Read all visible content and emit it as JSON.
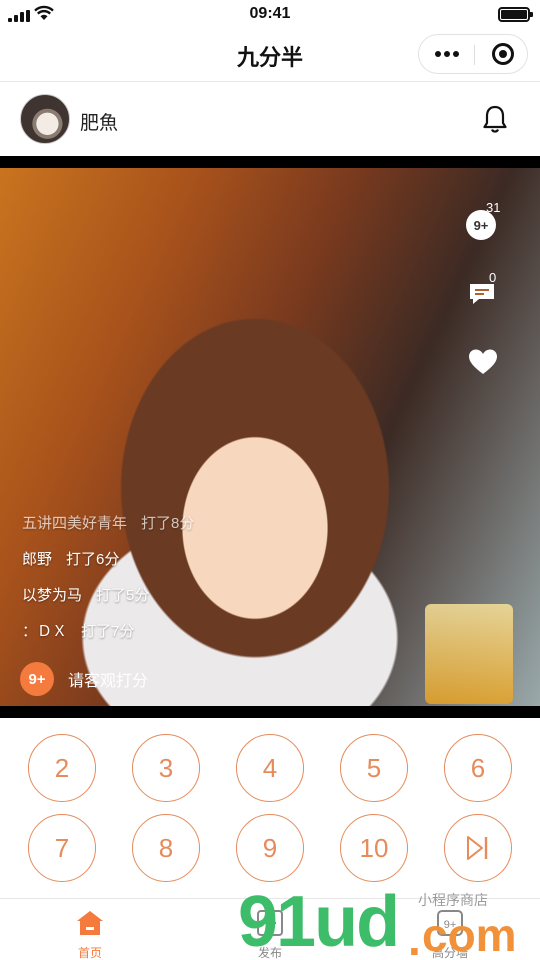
{
  "status_bar": {
    "time": "09:41"
  },
  "nav": {
    "title": "九分半"
  },
  "user": {
    "name": "肥魚"
  },
  "photo": {
    "actions": [
      {
        "icon": "score-icon",
        "label": "9+",
        "count": "31"
      },
      {
        "icon": "comment-icon",
        "count": "0"
      },
      {
        "icon": "heart-icon"
      }
    ],
    "ratings": [
      {
        "name": "五讲四美好青年",
        "action": "打了8分"
      },
      {
        "name": "郎野",
        "action": "打了6分"
      },
      {
        "name": "以梦为马",
        "action": "打了5分"
      },
      {
        "name": "：ＤＸ",
        "action": "打了7分"
      }
    ],
    "invite": {
      "badge": "9+",
      "text": "请客观打分"
    }
  },
  "scores": {
    "row1": [
      "2",
      "3",
      "4",
      "5",
      "6"
    ],
    "row2": [
      "7",
      "8",
      "9",
      "10"
    ],
    "skip_icon": "skip-next-icon"
  },
  "tabs": [
    {
      "label": "首页",
      "icon": "home-icon",
      "active": true
    },
    {
      "label": "发布",
      "icon": "add-icon",
      "active": false
    },
    {
      "label": "高分墙",
      "icon": "score-wall-icon",
      "active": false
    }
  ],
  "watermark": {
    "main": "91ud",
    "dot": ".",
    "com": "com",
    "shop": "小程序商店"
  },
  "colors": {
    "accent": "#f47b3d",
    "score_ring": "#e58b5c",
    "watermark_green": "#3dbd6a",
    "watermark_orange": "#f1913a"
  }
}
